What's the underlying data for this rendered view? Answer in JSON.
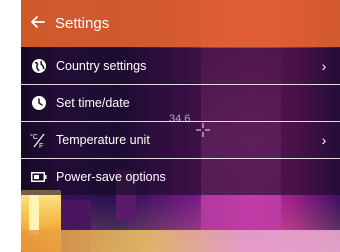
{
  "header": {
    "back_icon": "arrow-left-icon",
    "title": "Settings"
  },
  "menu": [
    {
      "label": "Country settings",
      "icon": "globe-icon",
      "has_chevron": true
    },
    {
      "label": "Set time/date",
      "icon": "clock-icon",
      "has_chevron": false
    },
    {
      "label": "Temperature unit",
      "icon": "celsius-fahrenheit-icon",
      "has_chevron": true
    },
    {
      "label": "Power-save options",
      "icon": "battery-icon",
      "has_chevron": false
    }
  ],
  "crosshair": {
    "reading": "34.6"
  },
  "colors": {
    "header_bg": "#e66428",
    "menu_bg": "#140a1e",
    "text": "#ffffff"
  }
}
